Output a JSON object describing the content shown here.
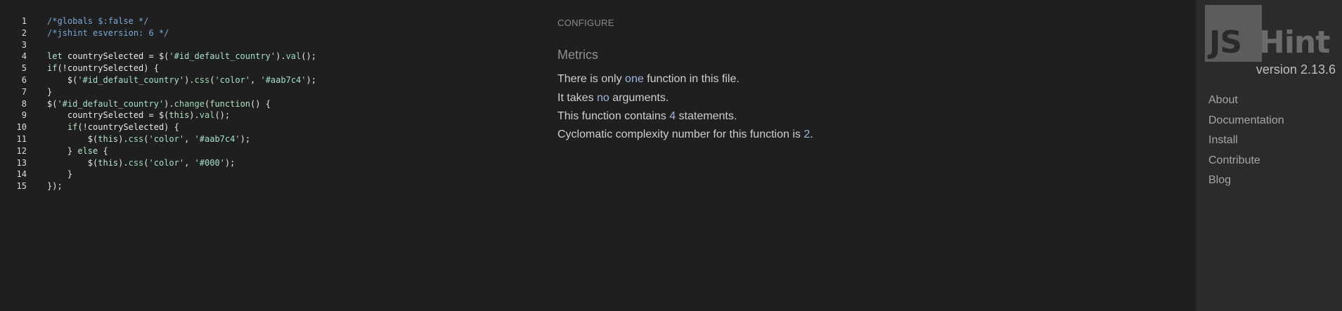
{
  "editor": {
    "lines": [
      {
        "n": "1",
        "segs": [
          {
            "c": "cm",
            "t": "/*globals $:false */"
          }
        ]
      },
      {
        "n": "2",
        "segs": [
          {
            "c": "cm",
            "t": "/*jshint esversion: 6 */"
          }
        ]
      },
      {
        "n": "3",
        "segs": []
      },
      {
        "n": "4",
        "segs": [
          {
            "c": "kw",
            "t": "let"
          },
          {
            "c": "code",
            "t": " countrySelected = $("
          },
          {
            "c": "str",
            "t": "'#id_default_country'"
          },
          {
            "c": "code",
            "t": ")."
          },
          {
            "c": "fn",
            "t": "val"
          },
          {
            "c": "code",
            "t": "();"
          }
        ]
      },
      {
        "n": "5",
        "segs": [
          {
            "c": "kw",
            "t": "if"
          },
          {
            "c": "code",
            "t": "(!countrySelected) {"
          }
        ]
      },
      {
        "n": "6",
        "segs": [
          {
            "c": "code",
            "t": "    $("
          },
          {
            "c": "str",
            "t": "'#id_default_country'"
          },
          {
            "c": "code",
            "t": ")."
          },
          {
            "c": "fn",
            "t": "css"
          },
          {
            "c": "code",
            "t": "("
          },
          {
            "c": "str",
            "t": "'color'"
          },
          {
            "c": "code",
            "t": ", "
          },
          {
            "c": "str",
            "t": "'#aab7c4'"
          },
          {
            "c": "code",
            "t": ");"
          }
        ]
      },
      {
        "n": "7",
        "segs": [
          {
            "c": "code",
            "t": "}"
          }
        ]
      },
      {
        "n": "8",
        "segs": [
          {
            "c": "code",
            "t": "$("
          },
          {
            "c": "str",
            "t": "'#id_default_country'"
          },
          {
            "c": "code",
            "t": ")."
          },
          {
            "c": "fn",
            "t": "change"
          },
          {
            "c": "code",
            "t": "("
          },
          {
            "c": "kw",
            "t": "function"
          },
          {
            "c": "code",
            "t": "() {"
          }
        ]
      },
      {
        "n": "9",
        "segs": [
          {
            "c": "code",
            "t": "    countrySelected = $("
          },
          {
            "c": "kw",
            "t": "this"
          },
          {
            "c": "code",
            "t": ")."
          },
          {
            "c": "fn",
            "t": "val"
          },
          {
            "c": "code",
            "t": "();"
          }
        ]
      },
      {
        "n": "10",
        "segs": [
          {
            "c": "code",
            "t": "    "
          },
          {
            "c": "kw",
            "t": "if"
          },
          {
            "c": "code",
            "t": "(!countrySelected) {"
          }
        ]
      },
      {
        "n": "11",
        "segs": [
          {
            "c": "code",
            "t": "        $("
          },
          {
            "c": "kw",
            "t": "this"
          },
          {
            "c": "code",
            "t": ")."
          },
          {
            "c": "fn",
            "t": "css"
          },
          {
            "c": "code",
            "t": "("
          },
          {
            "c": "str",
            "t": "'color'"
          },
          {
            "c": "code",
            "t": ", "
          },
          {
            "c": "str",
            "t": "'#aab7c4'"
          },
          {
            "c": "code",
            "t": ");"
          }
        ]
      },
      {
        "n": "12",
        "segs": [
          {
            "c": "code",
            "t": "    } "
          },
          {
            "c": "kw",
            "t": "else"
          },
          {
            "c": "code",
            "t": " {"
          }
        ]
      },
      {
        "n": "13",
        "segs": [
          {
            "c": "code",
            "t": "        $("
          },
          {
            "c": "kw",
            "t": "this"
          },
          {
            "c": "code",
            "t": ")."
          },
          {
            "c": "fn",
            "t": "css"
          },
          {
            "c": "code",
            "t": "("
          },
          {
            "c": "str",
            "t": "'color'"
          },
          {
            "c": "code",
            "t": ", "
          },
          {
            "c": "str",
            "t": "'#000'"
          },
          {
            "c": "code",
            "t": ");"
          }
        ]
      },
      {
        "n": "14",
        "segs": [
          {
            "c": "code",
            "t": "    }"
          }
        ]
      },
      {
        "n": "15",
        "segs": [
          {
            "c": "code",
            "t": "});"
          }
        ]
      }
    ]
  },
  "panel": {
    "configure": "CONFIGURE",
    "metrics_title": "Metrics",
    "metrics": [
      [
        {
          "t": "There is only "
        },
        {
          "t": "one",
          "hl": true
        },
        {
          "t": " function in this file."
        }
      ],
      [
        {
          "t": "It takes "
        },
        {
          "t": "no",
          "hl": true
        },
        {
          "t": " arguments."
        }
      ],
      [
        {
          "t": "This function contains "
        },
        {
          "t": "4",
          "hl": true
        },
        {
          "t": " statements."
        }
      ],
      [
        {
          "t": "Cyclomatic complexity number for this function is "
        },
        {
          "t": "2",
          "hl": true
        },
        {
          "t": "."
        }
      ]
    ]
  },
  "sidebar": {
    "logo_js": "JS",
    "logo_hint": "Hint",
    "version": "version 2.13.6",
    "links": [
      "About",
      "Documentation",
      "Install",
      "Contribute",
      "Blog"
    ]
  },
  "colors": {
    "background": "#1f1f1f",
    "sidebar": "#2b2b2b",
    "highlight": "#9db6e0"
  }
}
